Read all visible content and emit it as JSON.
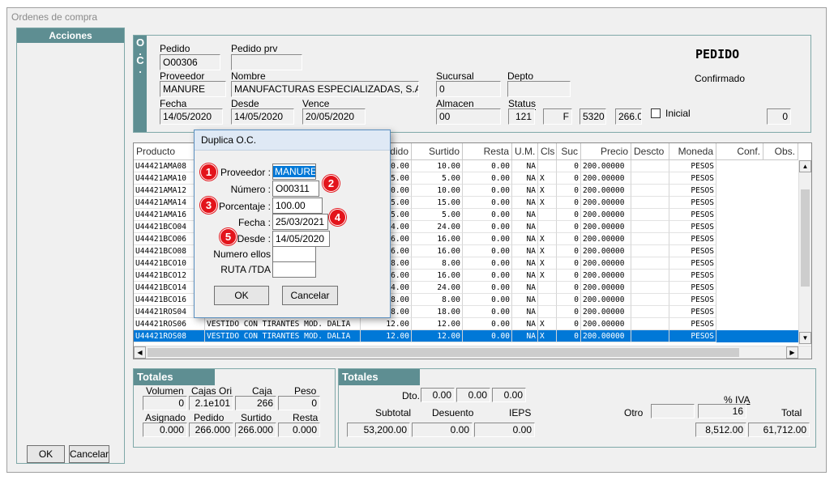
{
  "window_title": "Ordenes de compra",
  "sidebar": {
    "title": "Acciones",
    "ok_label": "OK",
    "cancel_label": "Cancelar"
  },
  "oc": {
    "strip_label": "O\n.\nC\n.",
    "pedido_label": "Pedido",
    "pedido": "O00306",
    "pedido_prv_label": "Pedido prv",
    "pedido_prv": "",
    "proveedor_label": "Proveedor",
    "proveedor": "MANURE",
    "nombre_label": "Nombre",
    "nombre": "MANUFACTURAS ESPECIALIZADAS, S.A.",
    "sucursal_label": "Sucursal",
    "sucursal": "0",
    "depto_label": "Depto",
    "depto": "",
    "fecha_label": "Fecha",
    "fecha": "14/05/2020",
    "desde_label": "Desde",
    "desde": "14/05/2020",
    "vence_label": "Vence",
    "vence": "20/05/2020",
    "almacen_label": "Almacen",
    "almacen": "00",
    "status_label": "Status",
    "status_num": "121",
    "status_code": "F",
    "status_val1": "5320",
    "status_val2": "266.0",
    "inicial_label": "Inicial",
    "right_val": "0",
    "doc_title": "PEDIDO",
    "doc_status": "Confirmado"
  },
  "grid": {
    "headers": [
      "Producto",
      "",
      "Pedido",
      "Surtido",
      "Resta",
      "U.M.",
      "Cls",
      "Suc",
      "Precio",
      "Descto",
      "Moneda",
      "Conf.",
      "Obs."
    ],
    "rows": [
      [
        "U44421AMA08",
        "",
        "10.00",
        "10.00",
        "0.00",
        "NA",
        "",
        "0",
        "200.00000",
        "",
        "PESOS"
      ],
      [
        "U44421AMA10",
        "",
        "5.00",
        "5.00",
        "0.00",
        "NA",
        "X",
        "0",
        "200.00000",
        "",
        "PESOS"
      ],
      [
        "U44421AMA12",
        "",
        "10.00",
        "10.00",
        "0.00",
        "NA",
        "X",
        "0",
        "200.00000",
        "",
        "PESOS"
      ],
      [
        "U44421AMA14",
        "",
        "15.00",
        "15.00",
        "0.00",
        "NA",
        "X",
        "0",
        "200.00000",
        "",
        "PESOS"
      ],
      [
        "U44421AMA16",
        "",
        "5.00",
        "5.00",
        "0.00",
        "NA",
        "",
        "0",
        "200.00000",
        "",
        "PESOS"
      ],
      [
        "U44421BCO04",
        "",
        "24.00",
        "24.00",
        "0.00",
        "NA",
        "",
        "0",
        "200.00000",
        "",
        "PESOS"
      ],
      [
        "U44421BCO06",
        "",
        "16.00",
        "16.00",
        "0.00",
        "NA",
        "X",
        "0",
        "200.00000",
        "",
        "PESOS"
      ],
      [
        "U44421BCO08",
        "",
        "16.00",
        "16.00",
        "0.00",
        "NA",
        "X",
        "0",
        "200.00000",
        "",
        "PESOS"
      ],
      [
        "U44421BCO10",
        "",
        "8.00",
        "8.00",
        "0.00",
        "NA",
        "X",
        "0",
        "200.00000",
        "",
        "PESOS"
      ],
      [
        "U44421BCO12",
        "",
        "16.00",
        "16.00",
        "0.00",
        "NA",
        "X",
        "0",
        "200.00000",
        "",
        "PESOS"
      ],
      [
        "U44421BCO14",
        "",
        "24.00",
        "24.00",
        "0.00",
        "NA",
        "",
        "0",
        "200.00000",
        "",
        "PESOS"
      ],
      [
        "U44421BCO16",
        "",
        "8.00",
        "8.00",
        "0.00",
        "NA",
        "",
        "0",
        "200.00000",
        "",
        "PESOS"
      ],
      [
        "U44421ROS04",
        "",
        "18.00",
        "18.00",
        "0.00",
        "NA",
        "",
        "0",
        "200.00000",
        "",
        "PESOS"
      ],
      [
        "U44421ROS06",
        "VESTIDO CON TIRANTES MOD. DALIA",
        "12.00",
        "12.00",
        "0.00",
        "NA",
        "X",
        "0",
        "200.00000",
        "",
        "PESOS"
      ],
      [
        "U44421ROS08",
        "VESTIDO CON TIRANTES MOD. DALIA",
        "12.00",
        "12.00",
        "0.00",
        "NA",
        "X",
        "0",
        "200.00000",
        "",
        "PESOS"
      ]
    ]
  },
  "totales_left": {
    "title": "Totales",
    "volumen_label": "Volumen",
    "volumen": "0",
    "cajas_ori_label": "Cajas Ori",
    "cajas_ori": "2.1e101",
    "caja_label": "Caja",
    "caja": "266",
    "peso_label": "Peso",
    "peso": "0",
    "asignado_label": "Asignado",
    "asignado": "0.000",
    "pedido_label": "Pedido",
    "pedido": "266.000",
    "surtido_label": "Surtido",
    "surtido": "266.000",
    "resta_label": "Resta",
    "resta": "0.000"
  },
  "totales_right": {
    "title": "Totales",
    "dto_label": "Dto.",
    "dto1": "0.00",
    "dto2": "0.00",
    "dto3": "0.00",
    "subtotal_label": "Subtotal",
    "subtotal": "53,200.00",
    "desuento_label": "Desuento",
    "desuento": "0.00",
    "ieps_label": "IEPS",
    "ieps": "0.00",
    "otro_label": "Otro",
    "otro": "",
    "iva_label": "% IVA",
    "iva_pct": "16",
    "iva": "8,512.00",
    "total_label": "Total",
    "total": "61,712.00"
  },
  "dialog": {
    "title": "Duplica O.C.",
    "proveedor_label": "Proveedor :",
    "proveedor": "MANURE",
    "numero_label": "Número :",
    "numero": "O00311",
    "porcentaje_label": "Porcentaje :",
    "porcentaje": "100.00",
    "fecha_label": "Fecha :",
    "fecha": "25/03/2021",
    "desde_label": "Desde :",
    "desde": "14/05/2020",
    "numero_ellos_label": "Numero ellos",
    "numero_ellos": "",
    "ruta_label": "RUTA /TDA",
    "ruta": "",
    "ok_label": "OK",
    "cancel_label": "Cancelar",
    "badges": [
      "1",
      "2",
      "3",
      "4",
      "5"
    ]
  },
  "colors": {
    "accent": "#5e8e92",
    "selection": "#0078d7",
    "badge": "#e3141b"
  }
}
